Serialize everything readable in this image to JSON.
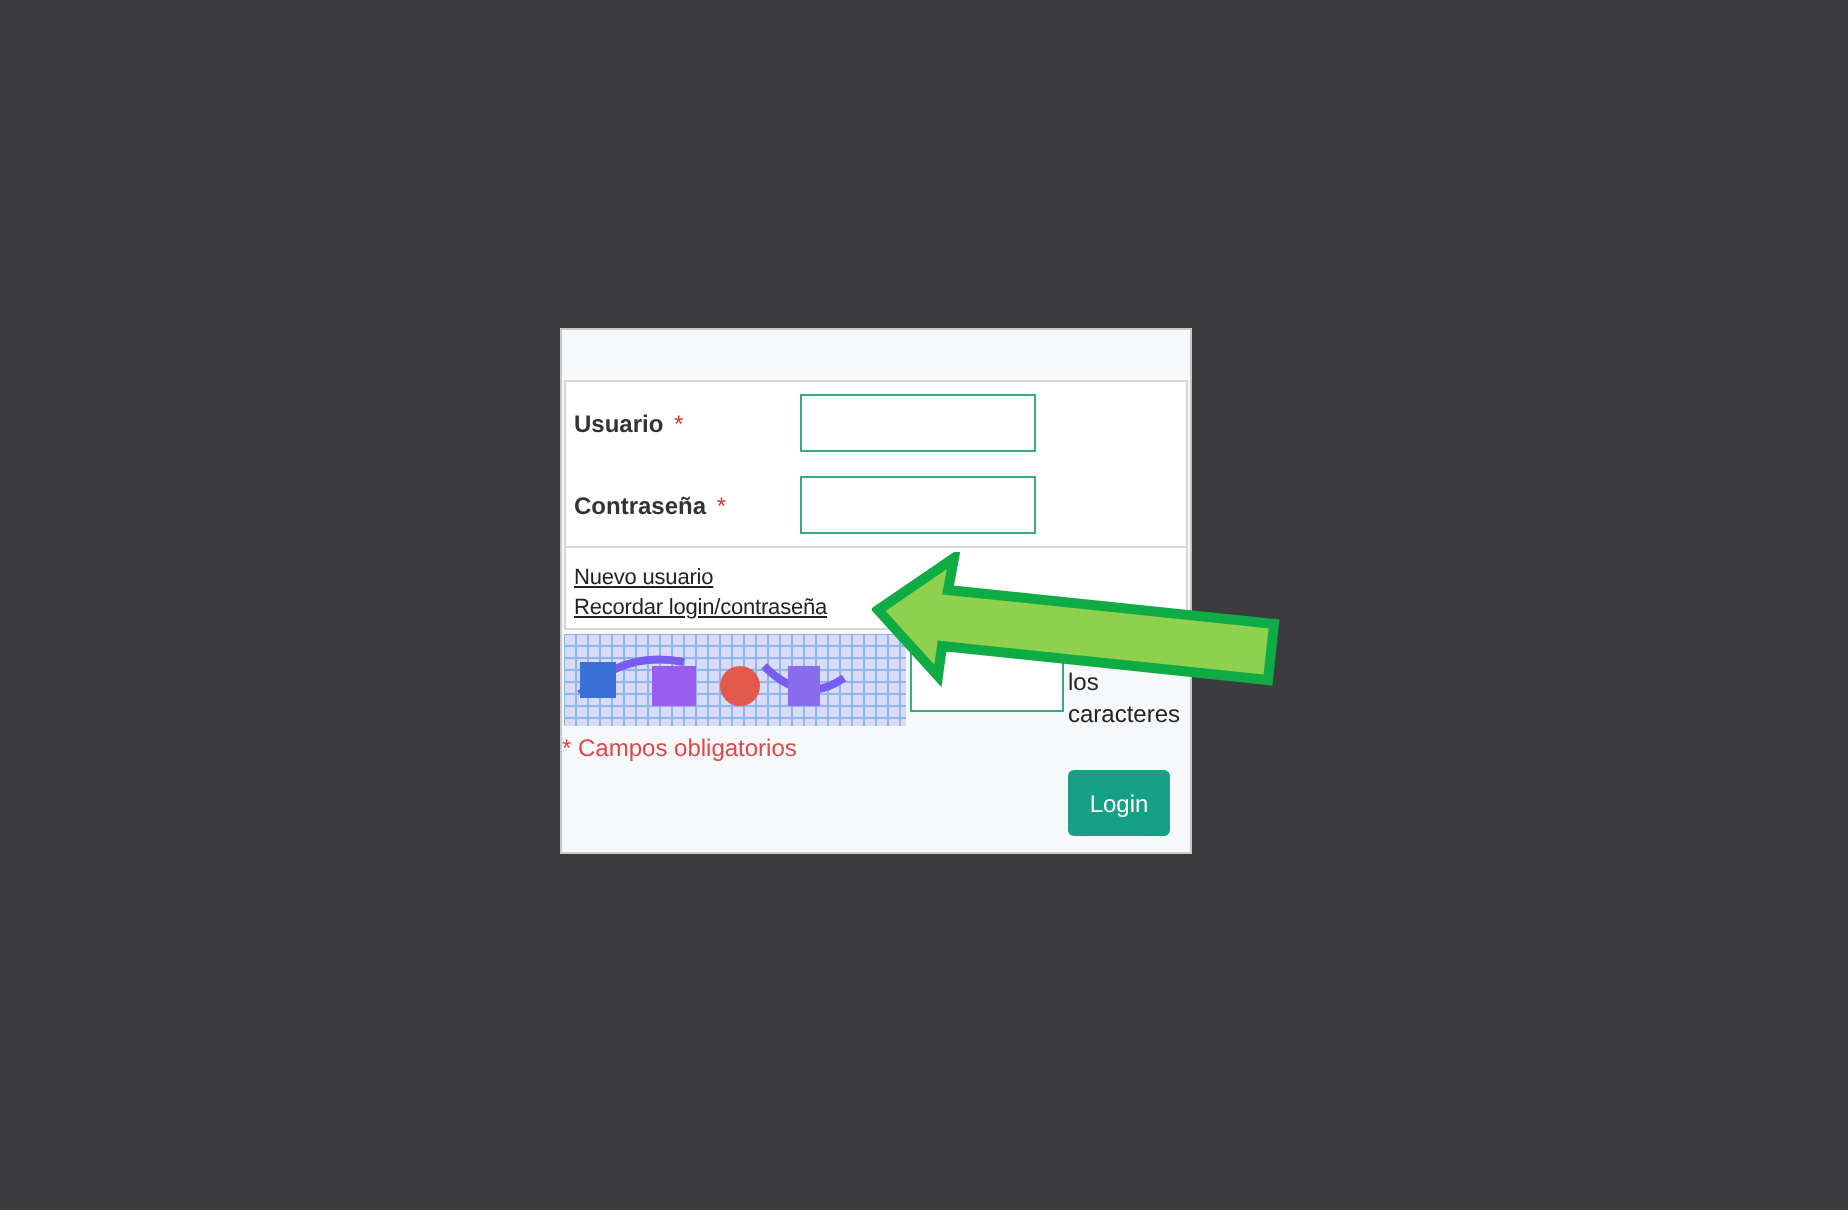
{
  "form": {
    "fields": [
      {
        "label": "Usuario",
        "required_mark": "*"
      },
      {
        "label": "Contraseña",
        "required_mark": "*"
      }
    ]
  },
  "links": [
    "Nuevo usuario",
    "Recordar login/contraseña"
  ],
  "captcha": {
    "kind": "picture",
    "hint_lines": [
      "los",
      "caracteres"
    ]
  },
  "required_note": "* Campos obligatorios",
  "login_button": "Login"
}
